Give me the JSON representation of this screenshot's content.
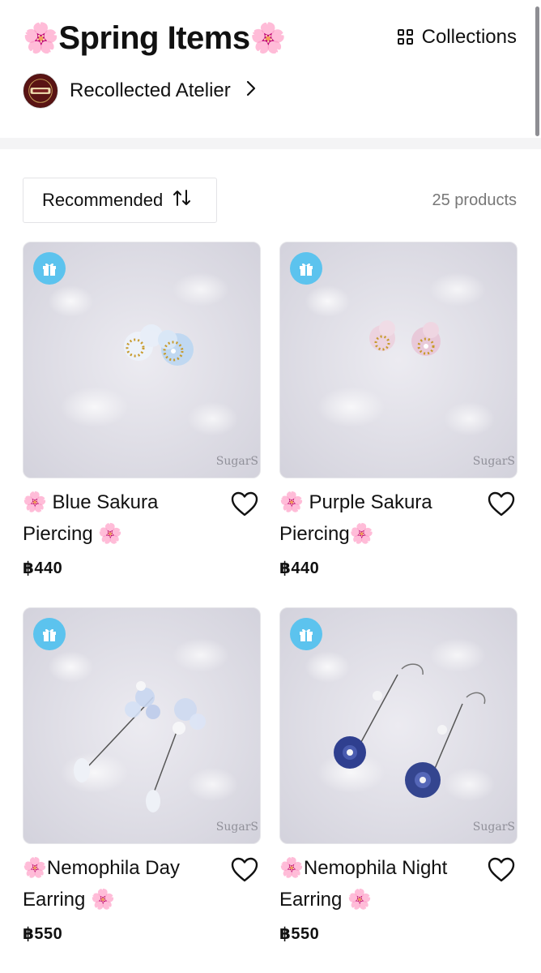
{
  "header": {
    "title": "Spring Items",
    "title_emoji": "🌸",
    "collections_label": "Collections",
    "shop_name": "Recollected Atelier"
  },
  "toolbar": {
    "sort_label": "Recommended",
    "product_count": "25 products"
  },
  "products": [
    {
      "name_line1": "🌸 Blue Sakura",
      "name_line2": "Piercing 🌸",
      "price": "฿440",
      "watermark": "SugarS",
      "accent": "#b9d4f0"
    },
    {
      "name_line1": "🌸 Purple Sakura",
      "name_line2": "Piercing🌸",
      "price": "฿440",
      "watermark": "SugarS",
      "accent": "#e6c6d8"
    },
    {
      "name_line1": "🌸Nemophila Day",
      "name_line2": "Earring 🌸",
      "price": "฿550",
      "watermark": "SugarS",
      "accent": "#c9d6f2"
    },
    {
      "name_line1": "🌸Nemophila Night",
      "name_line2": "Earring 🌸",
      "price": "฿550",
      "watermark": "SugarS",
      "accent": "#2f3f8f"
    }
  ],
  "colors": {
    "gift_badge": "#5cc3ee",
    "divider": "#f4f4f5"
  }
}
